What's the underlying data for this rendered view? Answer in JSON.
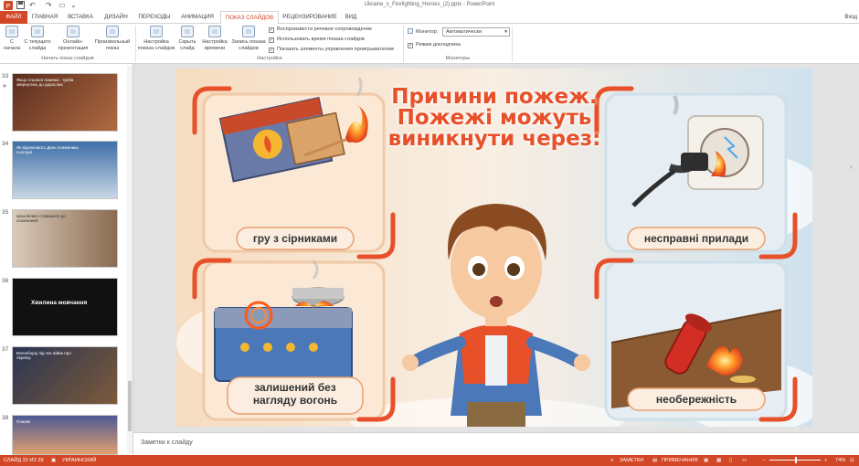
{
  "window": {
    "title": "Ukraine_s_Firefighting_Heroes_(2).pptx - PowerPoint",
    "login": "Вход"
  },
  "tabs": [
    "ФАЙЛ",
    "ГЛАВНАЯ",
    "ВСТАВКА",
    "ДИЗАЙН",
    "ПЕРЕХОДЫ",
    "АНИМАЦИЯ",
    "ПОКАЗ СЛАЙДОВ",
    "РЕЦЕНЗИРОВАНИЕ",
    "ВИД"
  ],
  "ribbon": {
    "start": {
      "from_start": "С начала",
      "from_current": "С текущего слайда",
      "online": "Онлайн-презентация",
      "custom": "Произвольный показ",
      "group": "Начать показ слайдов"
    },
    "setup": {
      "setup_show": "Настройка показа слайдов",
      "hide": "Скрыть слайд",
      "rehearse": "Настройка времени",
      "record": "Запись показа слайдов",
      "group": "Настройка"
    },
    "checks": {
      "narration": "Воспроизвести речевое сопровождение",
      "timings": "Использовать время показа слайдов",
      "controls": "Показать элементы управления проигрывателем"
    },
    "monitors": {
      "monitor_label": "Монитор:",
      "monitor_value": "Автоматически",
      "presenter": "Режим докладчика",
      "group": "Мониторы"
    }
  },
  "thumbnails": [
    {
      "num": "33",
      "star": "★",
      "text": "Якщо сталася пожежа - треба звернутись до дорослих",
      "bg": "#8a4a32"
    },
    {
      "num": "34",
      "text": "Як відзначають День пожежника сьогодні",
      "bg": "#5f89b8"
    },
    {
      "num": "35",
      "text": "Шанобливо ставимося до пожежників",
      "bg": "#b59c86"
    },
    {
      "num": "36",
      "text": "Хвилина мовчання",
      "bg": "#151515"
    },
    {
      "num": "37",
      "text": "Вогнеборці під час війни про Україну",
      "bg": "#3d4a6a"
    },
    {
      "num": "38",
      "text": "Пожежі",
      "bg": "#6a78a8"
    }
  ],
  "slide": {
    "title_l1": "Причини пожеж.",
    "title_l2": "Пожежі можуть",
    "title_l3": "виникнути через:",
    "captions": [
      "гру з сірниками",
      "несправні прилади",
      "залишений без нагляду вогонь",
      "необережність"
    ]
  },
  "notes": "Заметки к слайду",
  "status": {
    "slide": "СЛАЙД 32 ИЗ 39",
    "lang": "УКРАИНСКИЙ",
    "notes": "ЗАМЕТКИ",
    "comments": "ПРИМЕЧАНИЯ",
    "zoom": "74%"
  }
}
